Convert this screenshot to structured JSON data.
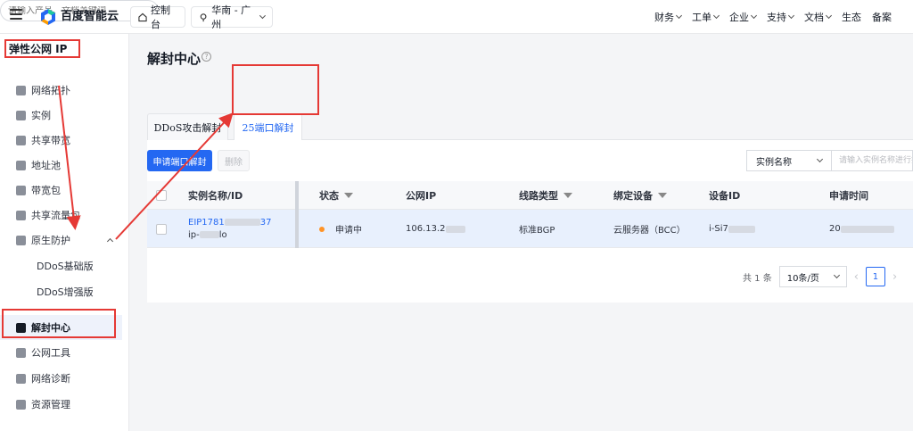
{
  "topbar": {
    "brand": "百度智能云",
    "console": "控制台",
    "region": "华南 - 广州",
    "search_placeholder": "请输入产品、文档关键词",
    "nav": [
      {
        "label": "财务",
        "chev": true
      },
      {
        "label": "工单",
        "chev": true
      },
      {
        "label": "企业",
        "chev": true
      },
      {
        "label": "支持",
        "chev": true
      },
      {
        "label": "文档",
        "chev": true
      },
      {
        "label": "生态",
        "chev": false
      },
      {
        "label": "备案",
        "chev": false
      }
    ],
    "logo_colors": [
      "#2468f2",
      "#1ec8a0",
      "#ff9d00",
      "#e53935"
    ]
  },
  "sidebar": {
    "title": "弹性公网 IP",
    "items": [
      {
        "label": "网络拓扑",
        "icon": "topology-icon"
      },
      {
        "label": "实例",
        "icon": "instance-icon"
      },
      {
        "label": "共享带宽",
        "icon": "shield-icon"
      },
      {
        "label": "地址池",
        "icon": "ip-pool-icon"
      },
      {
        "label": "带宽包",
        "icon": "package-icon"
      },
      {
        "label": "共享流量包",
        "icon": "traffic-icon"
      },
      {
        "label": "原生防护",
        "icon": "shield-icon"
      },
      {
        "label": "DDoS基础版",
        "icon": ""
      },
      {
        "label": "DDoS增强版",
        "icon": ""
      },
      {
        "label": "解封中心",
        "icon": "lock-icon"
      },
      {
        "label": "公网工具",
        "icon": "wrench-icon"
      },
      {
        "label": "网络诊断",
        "icon": "diagnose-icon"
      },
      {
        "label": "资源管理",
        "icon": "database-icon"
      }
    ]
  },
  "main": {
    "title": "解封中心",
    "tabs": [
      "DDoS攻击解封",
      "25端口解封"
    ],
    "apply_btn": "申请端口解封",
    "delete_btn": "删除",
    "filter_select": "实例名称",
    "filter_placeholder": "请输入实例名称进行搜索",
    "columns": [
      "实例名称/ID",
      "状态",
      "公网IP",
      "线路类型",
      "绑定设备",
      "设备ID",
      "申请时间"
    ],
    "row": {
      "name": "EIP1781",
      "name_suffix": "37",
      "id": "ip-",
      "id_suffix": "lo",
      "status": "申请中",
      "ip": "106.13.2",
      "line": "标准BGP",
      "device": "云服务器（BCC）",
      "device_id": "i-Si7",
      "time": "20"
    },
    "pager": {
      "total": "共 1 条",
      "size": "10条/页",
      "current": "1"
    },
    "accent": "#2468f2",
    "status_color": "#ff9326",
    "annotation_color": "#e53935"
  }
}
